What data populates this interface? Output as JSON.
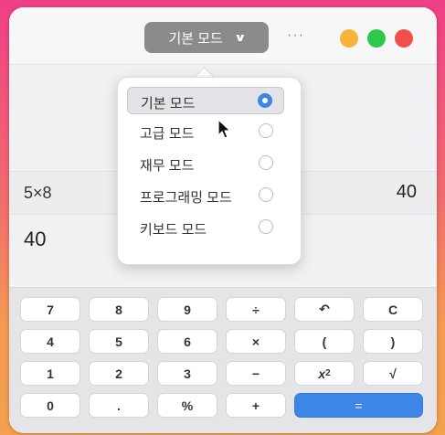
{
  "titlebar": {
    "mode_button_label": "기본 모드",
    "mode_button_chevron": "⌄",
    "more_label": "···",
    "traffic_lights": [
      {
        "name": "minimize",
        "color": "#f6b43a"
      },
      {
        "name": "zoom",
        "color": "#2ec94a"
      },
      {
        "name": "close",
        "color": "#f04f4a"
      }
    ]
  },
  "display": {
    "history_expression": "5×8",
    "history_result": "40",
    "current_value": "40"
  },
  "mode_menu": {
    "items": [
      {
        "label": "기본 모드",
        "selected": true
      },
      {
        "label": "고급 모드",
        "selected": false
      },
      {
        "label": "재무 모드",
        "selected": false
      },
      {
        "label": "프로그래밍 모드",
        "selected": false
      },
      {
        "label": "키보드 모드",
        "selected": false
      }
    ]
  },
  "keypad": {
    "rows": [
      [
        "7",
        "8",
        "9",
        "÷",
        "↶",
        "C"
      ],
      [
        "4",
        "5",
        "6",
        "×",
        "(",
        ")"
      ],
      [
        "1",
        "2",
        "3",
        "−",
        "x2",
        "√"
      ],
      [
        "0",
        ".",
        "%",
        "+",
        "="
      ]
    ]
  },
  "colors": {
    "accent": "#3e86e6",
    "background_top": "#ef3f86",
    "background_bottom": "#f3a14e"
  }
}
